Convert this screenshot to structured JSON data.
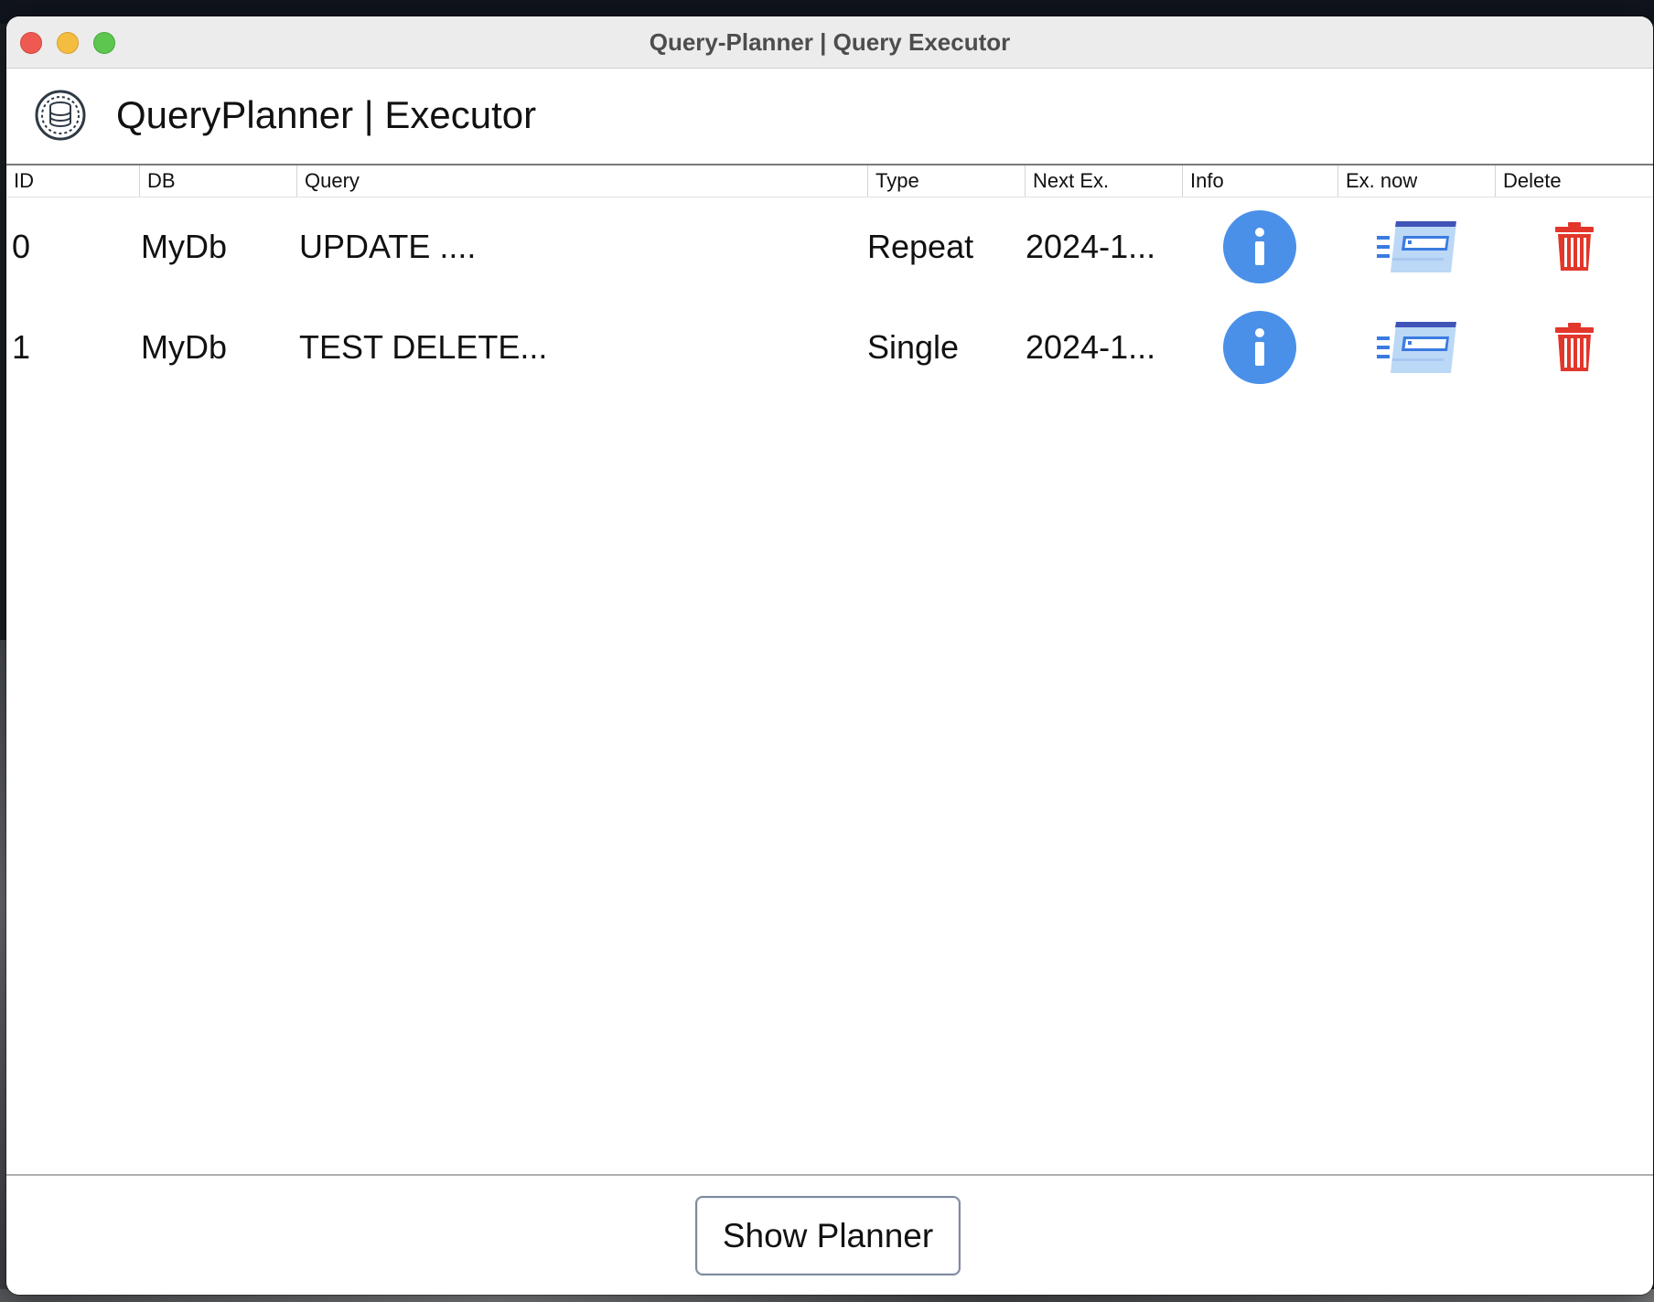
{
  "window": {
    "title": "Query-Planner | Query Executor"
  },
  "header": {
    "logo_icon": "database-gear-icon",
    "title": "QueryPlanner | Executor"
  },
  "table": {
    "columns": [
      "ID",
      "DB",
      "Query",
      "Type",
      "Next Ex.",
      "Info",
      "Ex. now",
      "Delete"
    ],
    "rows": [
      {
        "id": "0",
        "db": "MyDb",
        "query": "UPDATE ....",
        "type": "Repeat",
        "next_ex": "2024-1...",
        "info_icon": "info-icon",
        "exec_icon": "execute-window-icon",
        "delete_icon": "trash-icon"
      },
      {
        "id": "1",
        "db": "MyDb",
        "query": "TEST DELETE...",
        "type": "Single",
        "next_ex": "2024-1...",
        "info_icon": "info-icon",
        "exec_icon": "execute-window-icon",
        "delete_icon": "trash-icon"
      }
    ]
  },
  "footer": {
    "show_planner_label": "Show Planner"
  },
  "colors": {
    "info_blue": "#4a90e8",
    "delete_red": "#e2362b",
    "close": "#ee5a52",
    "minimize": "#f4bd40",
    "maximize": "#5dc64f"
  }
}
